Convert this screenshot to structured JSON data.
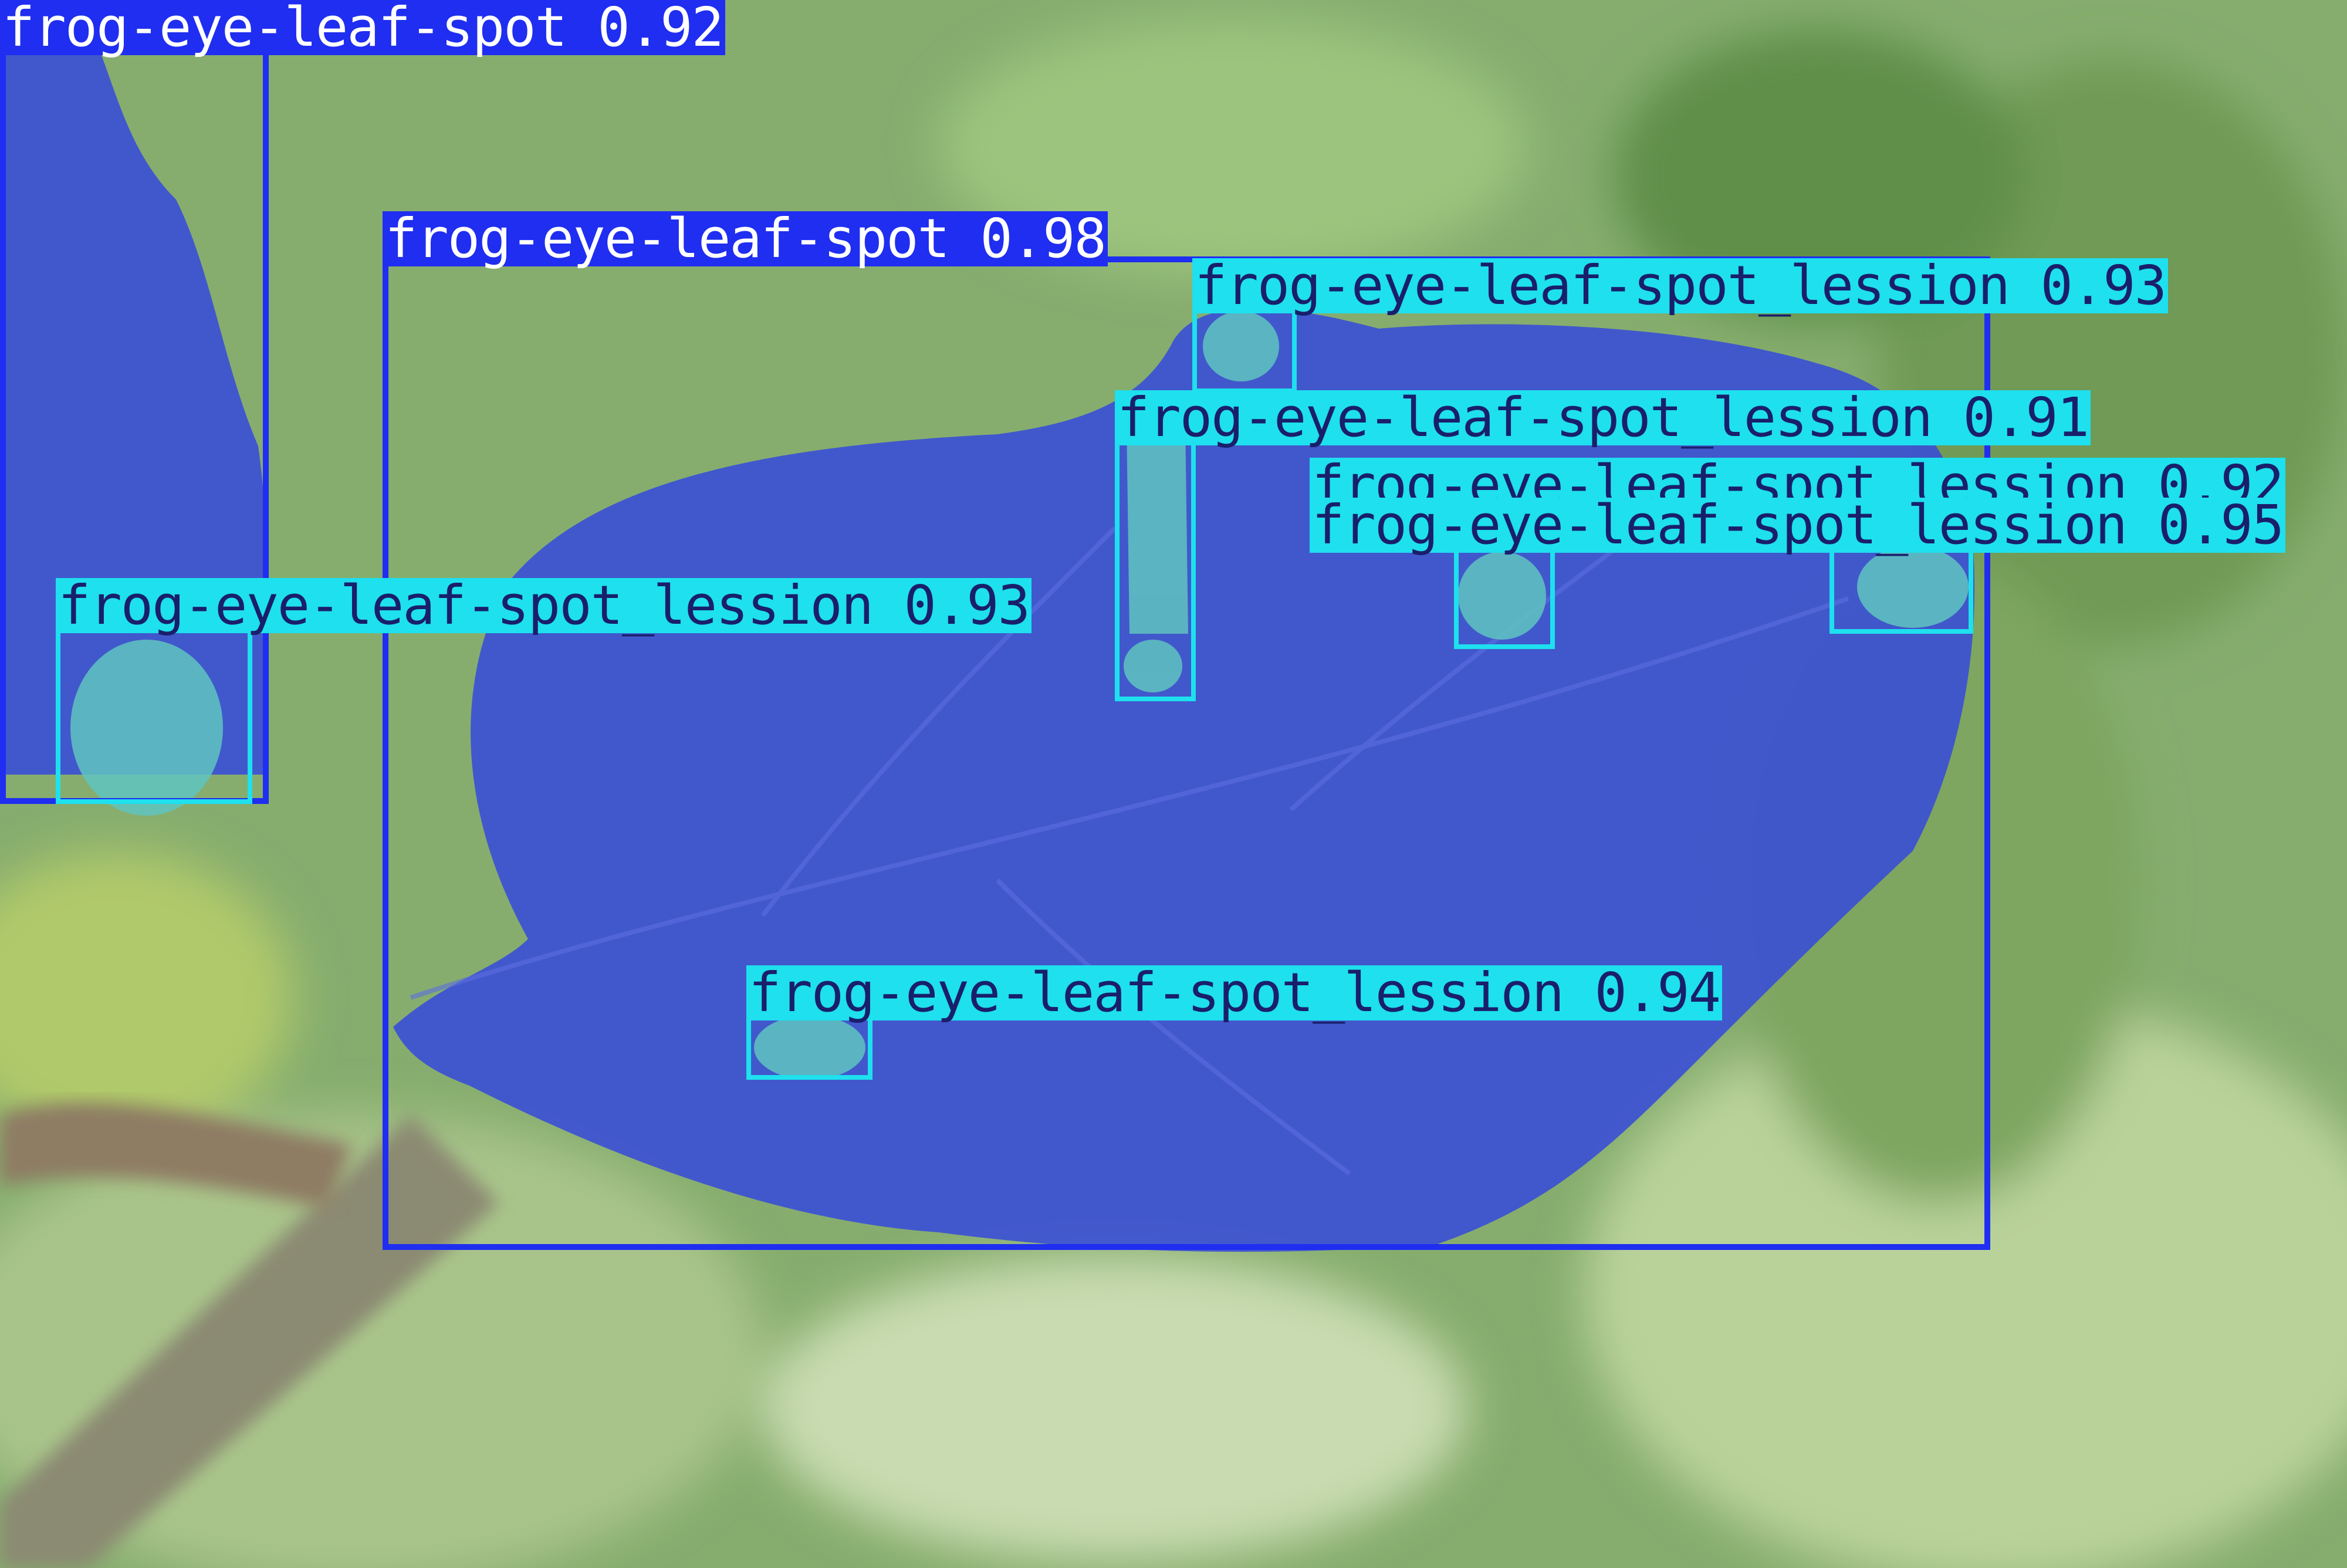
{
  "colors": {
    "leaf": "#1f2ef0",
    "leaf_mask": "#3a4fd6",
    "lesion": "#1ee0ee",
    "lesion_mask": "#5fc4c0",
    "leaf_text": "#ffffff",
    "lesion_text": "#1a1f6b"
  },
  "detections": [
    {
      "label": "frog-eye-leaf-spot 0.92",
      "class": "frog-eye-leaf-spot",
      "confidence": 0.92
    },
    {
      "label": "frog-eye-leaf-spot 0.98",
      "class": "frog-eye-leaf-spot",
      "confidence": 0.98
    },
    {
      "label": "frog-eye-leaf-spot_lession 0.93",
      "class": "frog-eye-leaf-spot_lession",
      "confidence": 0.93
    },
    {
      "label": "frog-eye-leaf-spot_lession 0.91",
      "class": "frog-eye-leaf-spot_lession",
      "confidence": 0.91
    },
    {
      "label": "frog-eye-leaf-spot_lession 0.92",
      "class": "frog-eye-leaf-spot_lession",
      "confidence": 0.92
    },
    {
      "label": "frog-eye-leaf-spot_lession 0.95",
      "class": "frog-eye-leaf-spot_lession",
      "confidence": 0.95
    },
    {
      "label": "frog-eye-leaf-spot_lession 0.93",
      "class": "frog-eye-leaf-spot_lession",
      "confidence": 0.93
    },
    {
      "label": "frog-eye-leaf-spot_lession 0.94",
      "class": "frog-eye-leaf-spot_lession",
      "confidence": 0.94
    }
  ]
}
